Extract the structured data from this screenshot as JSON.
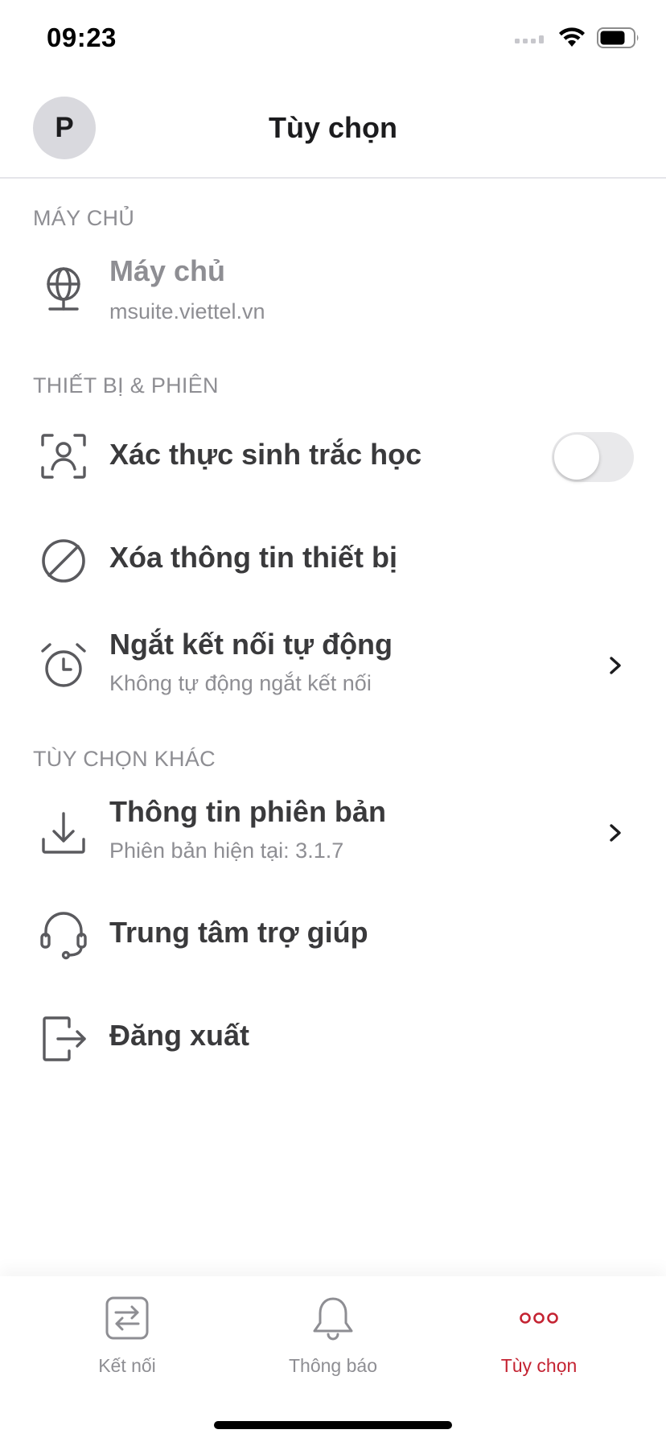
{
  "status_bar": {
    "time": "09:23"
  },
  "header": {
    "avatar_initial": "P",
    "title": "Tùy chọn"
  },
  "sections": {
    "server": "MÁY CHỦ",
    "device": "THIẾT BỊ & PHIÊN",
    "other": "TÙY CHỌN KHÁC"
  },
  "server_row": {
    "title": "Máy chủ",
    "value": "msuite.viettel.vn",
    "icon": "globe-icon"
  },
  "biometric_row": {
    "title": "Xác thực sinh trắc học",
    "enabled": false,
    "icon": "face-scan-icon"
  },
  "clear_device_row": {
    "title": "Xóa thông tin thiết bị",
    "icon": "block-icon"
  },
  "auto_disconnect_row": {
    "title": "Ngắt kết nối tự động",
    "subtitle": "Không tự động ngắt kết nối",
    "icon": "alarm-clock-icon"
  },
  "version_row": {
    "title": "Thông tin phiên bản",
    "subtitle": "Phiên bản hiện tại: 3.1.7",
    "icon": "download-icon"
  },
  "help_row": {
    "title": "Trung tâm trợ giúp",
    "icon": "headset-icon"
  },
  "logout_row": {
    "title": "Đăng xuất",
    "icon": "logout-icon"
  },
  "tabs": [
    {
      "label": "Kết nối",
      "icon": "swap-icon",
      "active": false
    },
    {
      "label": "Thông báo",
      "icon": "bell-icon",
      "active": false
    },
    {
      "label": "Tùy chọn",
      "icon": "more-icon",
      "active": true
    }
  ],
  "colors": {
    "accent": "#c42332",
    "text": "#3a3a3c",
    "muted": "#8e8e93",
    "icon": "#5a5a5e"
  }
}
